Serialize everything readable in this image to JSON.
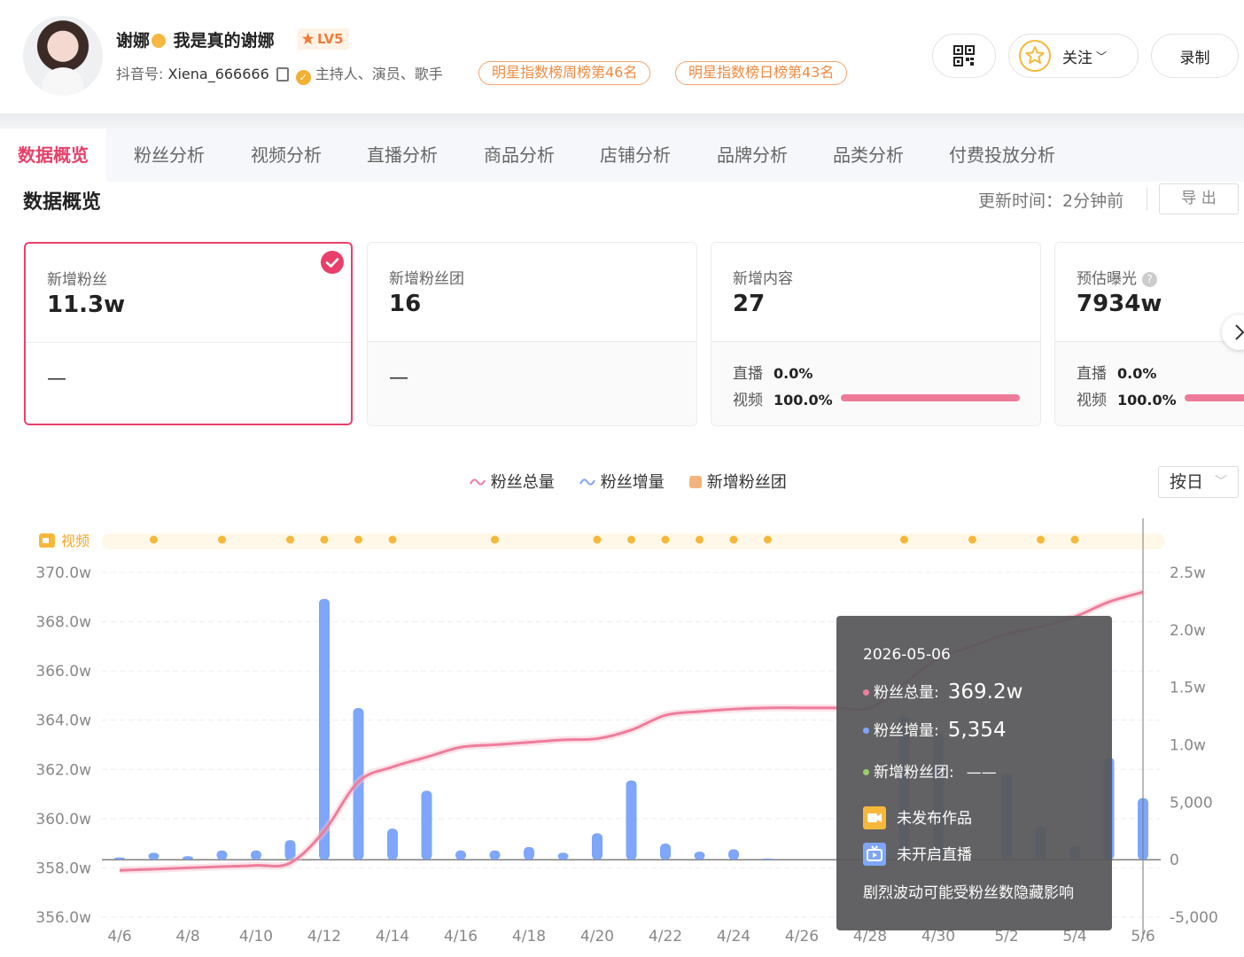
{
  "profile": {
    "name": "谢娜",
    "nickname": "我是真的谢娜",
    "level": "LV5",
    "douyin_label": "抖音号:",
    "douyin_id": "Xiena_666666",
    "roles": "主持人、演员、歌手",
    "rank_weekly": "明星指数榜周榜第46名",
    "rank_daily": "明星指数榜日榜第43名"
  },
  "actions": {
    "follow": "关注",
    "record": "录制"
  },
  "tabs": [
    "数据概览",
    "粉丝分析",
    "视频分析",
    "直播分析",
    "商品分析",
    "店铺分析",
    "品牌分析",
    "品类分析",
    "付费投放分析"
  ],
  "overview": {
    "title": "数据概览",
    "update_time": "更新时间：2分钟前",
    "export": "导 出"
  },
  "cards": [
    {
      "label": "新增粉丝",
      "value": "11.3w",
      "dash": "—"
    },
    {
      "label": "新增粉丝团",
      "value": "16",
      "dash": "—"
    },
    {
      "label": "新增内容",
      "value": "27",
      "live_label": "直播",
      "live_value": "0.0%",
      "video_label": "视频",
      "video_value": "100.0%",
      "video_fraction": 1.0
    },
    {
      "label": "预估曝光",
      "value": "7934w",
      "live_label": "直播",
      "live_value": "0.0%",
      "video_label": "视频",
      "video_value": "100.0%",
      "video_fraction": 1.0
    }
  ],
  "legend": {
    "total": "粉丝总量",
    "increase": "粉丝增量",
    "club": "新增粉丝团",
    "range": "按日"
  },
  "colors": {
    "accent": "#e8406a",
    "line": "#ee7d9c",
    "bar": "#7ea6fa",
    "club": "#f3b37e",
    "video_marker": "#f5b83a"
  },
  "chart_data": {
    "type": "bar+line",
    "video_track_label": "视频",
    "x_ticks": [
      "4/6",
      "4/8",
      "4/10",
      "4/12",
      "4/14",
      "4/16",
      "4/18",
      "4/20",
      "4/22",
      "4/24",
      "4/26",
      "4/28",
      "4/30",
      "5/2",
      "5/4",
      "5/6"
    ],
    "y_left_ticks": [
      "370.0w",
      "368.0w",
      "366.0w",
      "364.0w",
      "362.0w",
      "360.0w",
      "358.0w",
      "356.0w"
    ],
    "y_left_range": [
      356.0,
      370.0
    ],
    "y_right_ticks": [
      "2.5w",
      "2.0w",
      "1.5w",
      "1.0w",
      "5,000",
      "0",
      "-5,000"
    ],
    "y_right_range": [
      -5000,
      25000
    ],
    "dates": [
      "4/6",
      "4/7",
      "4/8",
      "4/9",
      "4/10",
      "4/11",
      "4/12",
      "4/13",
      "4/14",
      "4/15",
      "4/16",
      "4/17",
      "4/18",
      "4/19",
      "4/20",
      "4/21",
      "4/22",
      "4/23",
      "4/24",
      "4/25",
      "4/26",
      "4/27",
      "4/28",
      "4/29",
      "4/30",
      "5/1",
      "5/2",
      "5/3",
      "5/4",
      "5/5",
      "5/6"
    ],
    "series": [
      {
        "name": "粉丝增量",
        "type": "bar",
        "axis": "right",
        "values": [
          200,
          600,
          300,
          800,
          800,
          1700,
          22700,
          13200,
          2700,
          6000,
          800,
          800,
          1100,
          600,
          2300,
          6900,
          1400,
          700,
          900,
          100,
          0,
          0,
          0,
          12500,
          11000,
          0,
          7500,
          2900,
          1200,
          8900,
          5354
        ]
      },
      {
        "name": "粉丝总量",
        "type": "line",
        "axis": "left",
        "values": [
          357.9,
          357.95,
          358.0,
          358.05,
          358.1,
          358.2,
          359.5,
          361.5,
          362.1,
          362.5,
          362.9,
          363.0,
          363.1,
          363.2,
          363.25,
          363.6,
          364.2,
          364.35,
          364.45,
          364.5,
          364.5,
          364.5,
          364.5,
          365.5,
          366.5,
          367.0,
          367.5,
          367.8,
          368.2,
          368.8,
          369.2
        ]
      }
    ],
    "video_days": [
      "4/7",
      "4/9",
      "4/11",
      "4/12",
      "4/13",
      "4/14",
      "4/17",
      "4/20",
      "4/21",
      "4/22",
      "4/23",
      "4/24",
      "4/25",
      "4/29",
      "5/1",
      "5/3",
      "5/4"
    ]
  },
  "tooltip": {
    "date": "2026-05-06",
    "total_label": "粉丝总量:",
    "total_value": "369.2w",
    "increase_label": "粉丝增量:",
    "increase_value": "5,354",
    "club_label": "新增粉丝团:",
    "club_value": "——",
    "video_status": "未发布作品",
    "live_status": "未开启直播",
    "note": "剧烈波动可能受粉丝数隐藏影响"
  }
}
